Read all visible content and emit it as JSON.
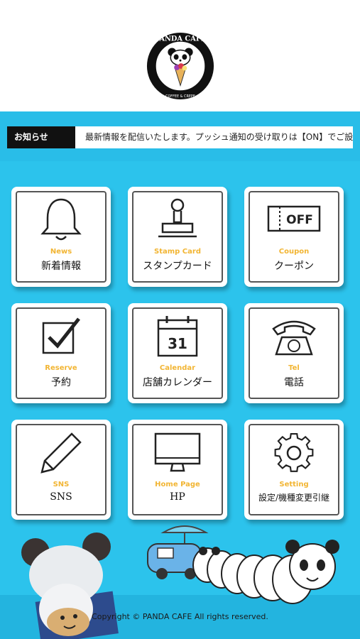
{
  "header": {
    "logo_text_top": "PANDA CAFE",
    "logo_text_bottom": "COFFEE & CREPE"
  },
  "news": {
    "label": "お知らせ",
    "text": "最新情報を配信いたします。プッシュ通知の受け取りは【ON】でご設定"
  },
  "menu": [
    {
      "en": "News",
      "ja": "新着情報",
      "icon": "bell-icon"
    },
    {
      "en": "Stamp Card",
      "ja": "スタンプカード",
      "icon": "stamp-icon"
    },
    {
      "en": "Coupon",
      "ja": "クーポン",
      "icon": "coupon-icon",
      "icon_text": "OFF"
    },
    {
      "en": "Reserve",
      "ja": "予約",
      "icon": "checkbox-icon"
    },
    {
      "en": "Calendar",
      "ja": "店舗カレンダー",
      "icon": "calendar-icon",
      "icon_text": "31"
    },
    {
      "en": "Tel",
      "ja": "電話",
      "icon": "telephone-icon"
    },
    {
      "en": "SNS",
      "ja": "SNS",
      "icon": "pencil-icon"
    },
    {
      "en": "Home Page",
      "ja": "HP",
      "icon": "monitor-icon"
    },
    {
      "en": "Setting",
      "ja": "設定/機種変更引継",
      "icon": "gear-icon"
    }
  ],
  "footer": {
    "copyright": "Copyright © PANDA CAFE All rights reserved."
  },
  "colors": {
    "background": "#2cc3ec",
    "accent": "#f2b533",
    "label_bg": "#111111"
  }
}
